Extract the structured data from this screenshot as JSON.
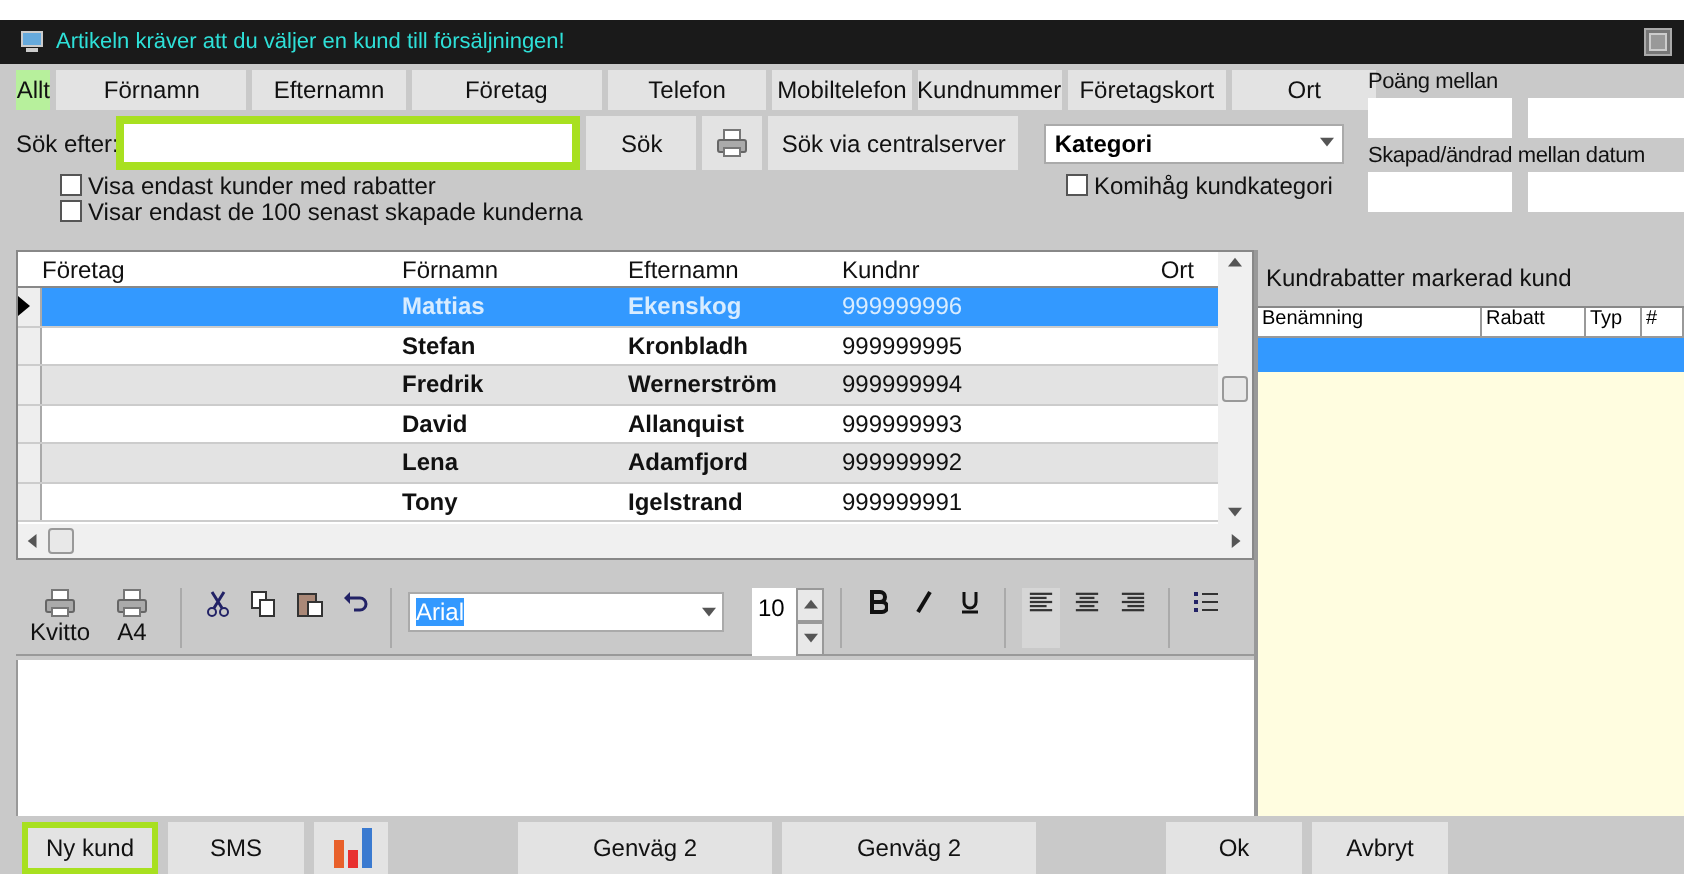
{
  "window": {
    "title": "Artikeln kräver att du väljer en kund till försäljningen!"
  },
  "search_tabs": [
    {
      "label": "Allt",
      "selected": true
    },
    {
      "label": "Förnamn",
      "selected": false
    },
    {
      "label": "Efternamn",
      "selected": false
    },
    {
      "label": "Företag",
      "selected": false
    },
    {
      "label": "Telefon",
      "selected": false
    },
    {
      "label": "Mobiltelefon",
      "selected": false
    },
    {
      "label": "Kundnummer",
      "selected": false
    },
    {
      "label": "Företagskort",
      "selected": false
    },
    {
      "label": "Ort",
      "selected": false
    }
  ],
  "search": {
    "label": "Sök efter:",
    "highlighted": true,
    "search_button": "Sök",
    "central_button": "Sök via centralserver",
    "category": "Kategori",
    "remember_category": {
      "label": "Komihåg kundkategori",
      "checked": false
    }
  },
  "filters": [
    {
      "label": "Visa endast kunder med rabatter",
      "checked": false
    },
    {
      "label": "Visar endast de 100 senast skapade kunderna",
      "checked": false
    }
  ],
  "range_fields": [
    {
      "label": "Poäng mellan"
    },
    {
      "label": "Skapad/ändrad mellan datum"
    }
  ],
  "customers": {
    "columns": [
      "Företag",
      "Förnamn",
      "Efternamn",
      "Kundnr",
      "Ort"
    ],
    "rows": [
      {
        "first": "Mattias",
        "last": "Ekenskog",
        "number": "999999996",
        "selected": true
      },
      {
        "first": "Stefan",
        "last": "Kronbladh",
        "number": "999999995",
        "selected": false
      },
      {
        "first": "Fredrik",
        "last": "Wernerström",
        "number": "999999994",
        "selected": false
      },
      {
        "first": "David",
        "last": "Allanquist",
        "number": "999999993",
        "selected": false
      },
      {
        "first": "Lena",
        "last": "Adamfjord",
        "number": "999999992",
        "selected": false
      },
      {
        "first": "Tony",
        "last": "Igelstrand",
        "number": "999999991",
        "selected": false
      }
    ]
  },
  "discounts": {
    "title": "Kundrabatter markerad kund",
    "columns": [
      "Benämning",
      "Rabatt",
      "Typ",
      "#"
    ]
  },
  "editor": {
    "print_buttons": [
      "Kvitto",
      "A4"
    ],
    "font": "Arial",
    "size": "10",
    "alignments": [
      {
        "kind": "left",
        "selected": true
      },
      {
        "kind": "center",
        "selected": false
      },
      {
        "kind": "right",
        "selected": false
      }
    ]
  },
  "bottom_buttons": [
    {
      "kind": "text",
      "label": "Ny kund",
      "highlighted": true
    },
    {
      "kind": "text",
      "label": "SMS",
      "highlighted": false
    },
    {
      "kind": "chart",
      "highlighted": false
    },
    {
      "kind": "spacer"
    },
    {
      "kind": "wide",
      "label": "Genväg 2",
      "highlighted": false
    },
    {
      "kind": "wide",
      "label": "Genväg 2",
      "highlighted": false
    },
    {
      "kind": "spacer"
    },
    {
      "kind": "text",
      "label": "Ok",
      "highlighted": false
    },
    {
      "kind": "text",
      "label": "Avbryt",
      "highlighted": false
    }
  ]
}
